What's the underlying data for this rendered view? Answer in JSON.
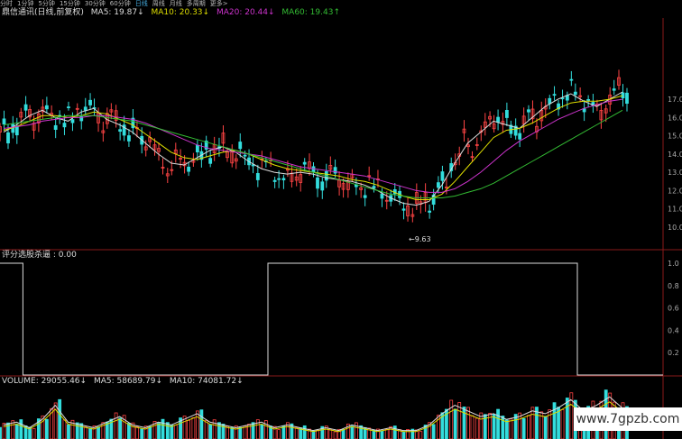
{
  "period_bar": {
    "items": [
      "分时",
      "1分钟",
      "5分钟",
      "15分钟",
      "30分钟",
      "60分钟",
      "日线",
      "周线",
      "月线",
      "多周期",
      "更多&gt;"
    ],
    "active_index": 6
  },
  "header": {
    "stock": "鼎信通讯(日线,前复权)",
    "ma5": "MA5: 19.87↓",
    "ma10": "MA10: 20.33↓",
    "ma20": "MA20: 20.44↓",
    "ma60": "MA60: 19.43↑"
  },
  "indicator_panel": {
    "title": "评分选股杀逼 : 0.00"
  },
  "volume_panel": {
    "vol": "VOLUME: 29055.46↓",
    "ma5": "MA5: 58689.79↓",
    "ma10": "MA10: 74081.72↓"
  },
  "price_axis": {
    "labels": [
      "17.0",
      "16.0",
      "15.0",
      "14.0",
      "13.0",
      "12.0",
      "11.0",
      "10.0"
    ]
  },
  "indicator_axis": {
    "labels": [
      "1.0",
      "0.8",
      "0.6",
      "0.4",
      "0.2"
    ]
  },
  "annotations": {
    "low_price": "9.63"
  },
  "watermark": "www.7gpzb.com",
  "colors": {
    "ma5": "#dddddd",
    "ma10": "#e0e000",
    "ma20": "#cc33cc",
    "ma60": "#33bb33",
    "up": "#ff4444",
    "down": "#33dddd"
  },
  "chart_data": {
    "type": "candlestick",
    "series": [
      {
        "name": "MA5",
        "values": [
          15.2,
          15.6,
          16.1,
          16.4,
          16.0,
          15.8,
          16.3,
          16.5,
          15.9,
          15.6,
          15.2,
          14.6,
          14.0,
          13.5,
          13.4,
          13.8,
          14.2,
          14.4,
          14.1,
          13.6,
          13.2,
          13.0,
          12.9,
          13.0,
          12.9,
          12.7,
          12.6,
          12.5,
          12.3,
          12.0,
          11.6,
          11.3,
          11.2,
          11.4,
          12.3,
          13.5,
          14.6,
          15.2,
          15.8,
          15.6,
          15.4,
          16.0,
          16.6,
          17.0,
          17.3,
          16.9,
          16.6,
          17.0,
          17.4
        ]
      },
      {
        "name": "MA10",
        "values": [
          15.3,
          15.5,
          15.8,
          16.1,
          16.1,
          16.0,
          16.1,
          16.3,
          16.2,
          15.9,
          15.6,
          15.1,
          14.6,
          14.1,
          13.8,
          13.7,
          13.9,
          14.1,
          14.2,
          14.0,
          13.7,
          13.4,
          13.2,
          13.1,
          13.0,
          12.9,
          12.8,
          12.6,
          12.5,
          12.3,
          12.0,
          11.7,
          11.5,
          11.5,
          11.8,
          12.5,
          13.3,
          14.1,
          14.9,
          15.3,
          15.4,
          15.7,
          16.1,
          16.5,
          16.8,
          16.9,
          16.9,
          17.0,
          17.2
        ]
      },
      {
        "name": "MA20",
        "values": [
          15.4,
          15.5,
          15.6,
          15.8,
          15.9,
          16.0,
          16.0,
          16.1,
          16.1,
          16.0,
          15.9,
          15.7,
          15.4,
          15.1,
          14.8,
          14.5,
          14.3,
          14.2,
          14.1,
          14.0,
          13.9,
          13.7,
          13.5,
          13.3,
          13.2,
          13.1,
          13.0,
          12.9,
          12.8,
          12.6,
          12.4,
          12.2,
          12.0,
          11.9,
          11.9,
          12.1,
          12.5,
          13.0,
          13.6,
          14.2,
          14.7,
          15.1,
          15.5,
          15.9,
          16.2,
          16.5,
          16.7,
          16.9,
          17.0
        ]
      },
      {
        "name": "MA60",
        "values": [
          15.6,
          15.7,
          15.8,
          15.9,
          16.0,
          16.1,
          16.1,
          16.1,
          16.0,
          15.9,
          15.8,
          15.6,
          15.4,
          15.2,
          15.0,
          14.8,
          14.6,
          14.4,
          14.2,
          14.0,
          13.8,
          13.6,
          13.4,
          13.2,
          13.0,
          12.8,
          12.6,
          12.4,
          12.2,
          12.0,
          11.8,
          11.7,
          11.6,
          11.6,
          11.6,
          11.7,
          11.9,
          12.1,
          12.4,
          12.8,
          13.2,
          13.6,
          14.0,
          14.4,
          14.8,
          15.2,
          15.6,
          16.0,
          16.4
        ]
      }
    ],
    "indicator": {
      "values": [
        1,
        1,
        0,
        0,
        0,
        0,
        0,
        0,
        0,
        0,
        0,
        0,
        0,
        0,
        0,
        0,
        0,
        0,
        0,
        0,
        0,
        1,
        1,
        1,
        1,
        1,
        1,
        1,
        1,
        1,
        1,
        1,
        1,
        1,
        1,
        1,
        1,
        1,
        1,
        1,
        1,
        1,
        1,
        1,
        1,
        0,
        0,
        0,
        0
      ],
      "ylim": [
        0,
        1
      ]
    },
    "volume": {
      "values": [
        5,
        6,
        4,
        7,
        12,
        6,
        5,
        4,
        6,
        8,
        5,
        4,
        6,
        5,
        7,
        9,
        6,
        5,
        4,
        5,
        6,
        4,
        5,
        4,
        3,
        4,
        3,
        5,
        4,
        3,
        4,
        3,
        3,
        5,
        9,
        12,
        10,
        8,
        9,
        7,
        8,
        10,
        9,
        11,
        14,
        10,
        12,
        15,
        11
      ]
    },
    "ylim": [
      9.5,
      17.5
    ]
  }
}
